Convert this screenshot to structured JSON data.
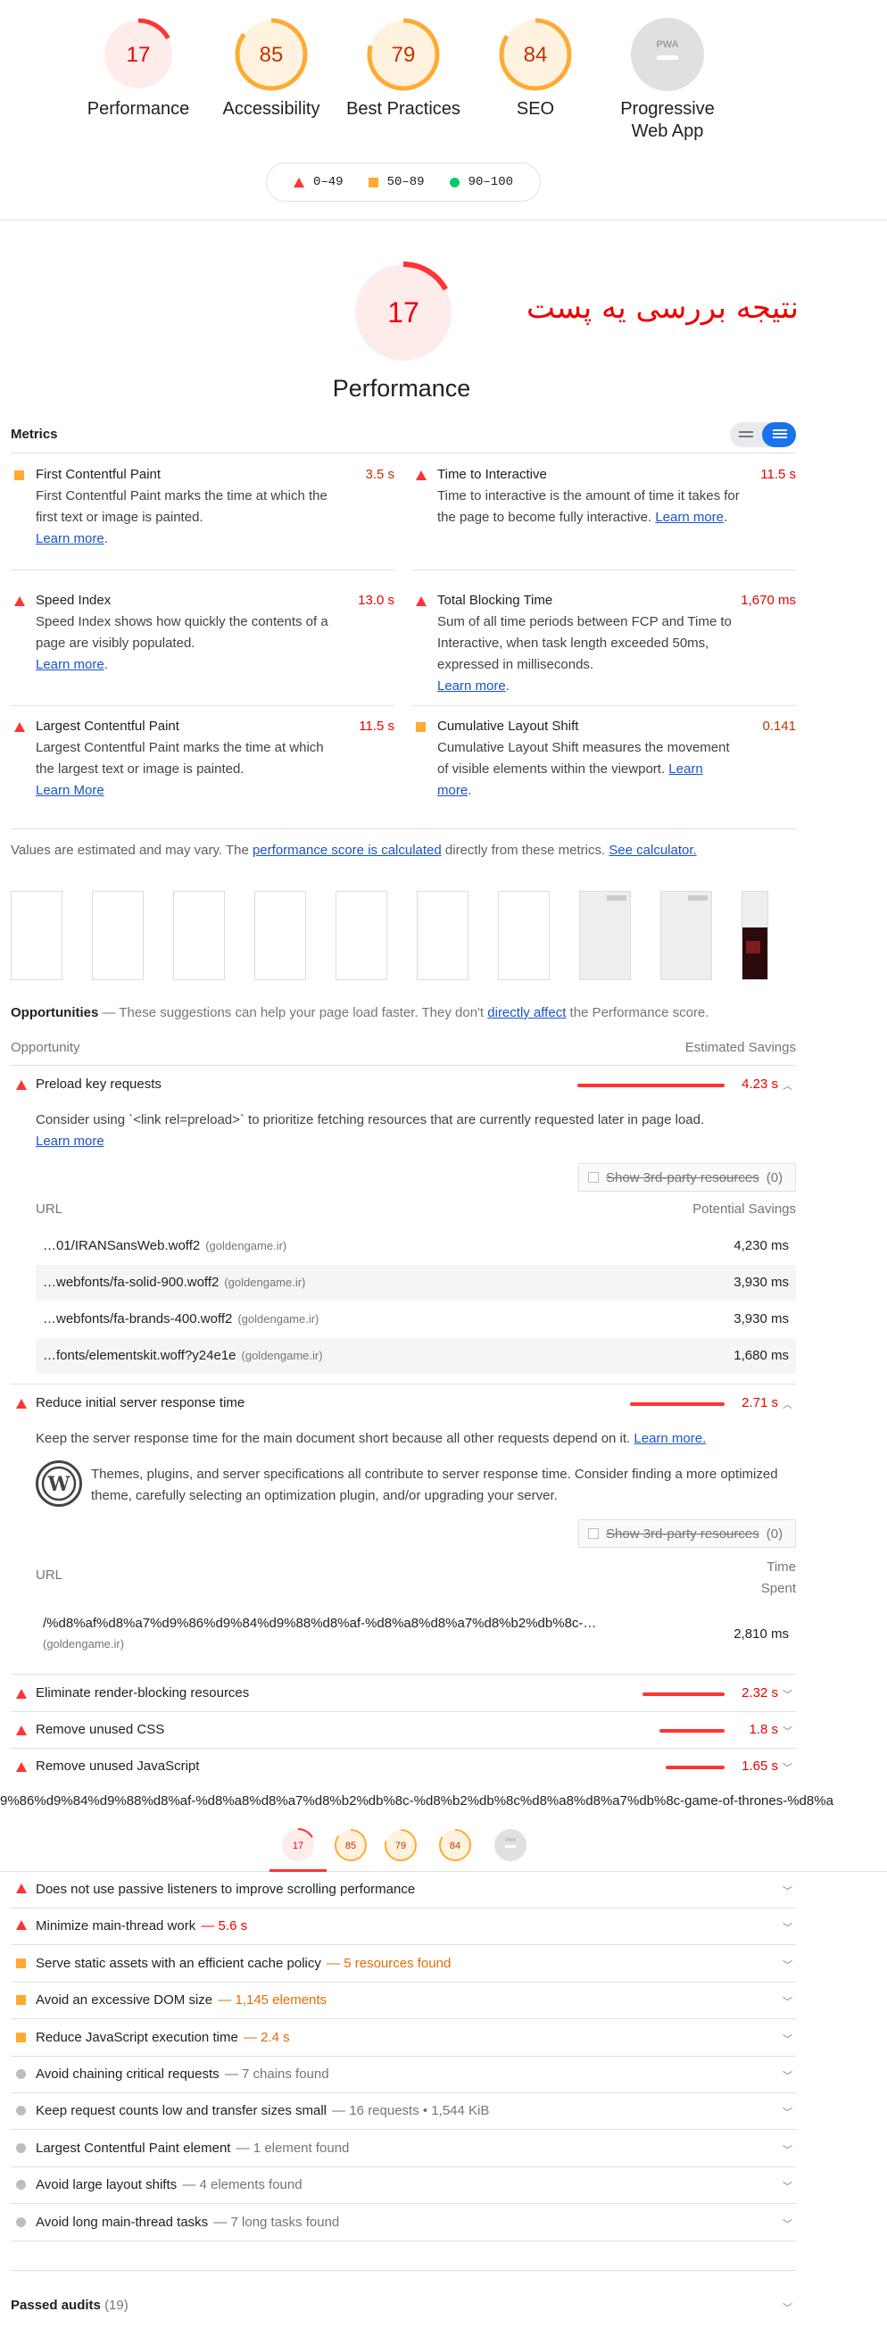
{
  "categories": [
    {
      "score": "17",
      "label": "Performance",
      "color": "#ff3333",
      "bg": "#fdecea",
      "fraction": 0.17
    },
    {
      "score": "85",
      "label": "Accessibility",
      "color": "#ffaa33",
      "bg": "#fff3e0",
      "fraction": 0.85
    },
    {
      "score": "79",
      "label": "Best Practices",
      "color": "#ffaa33",
      "bg": "#fff3e0",
      "fraction": 0.79
    },
    {
      "score": "84",
      "label": "SEO",
      "color": "#ffaa33",
      "bg": "#fff3e0",
      "fraction": 0.84
    },
    {
      "score": "PWA",
      "label": "Progressive Web App",
      "color": "#9e9e9e",
      "bg": "#e0e0e0",
      "fraction": 0
    }
  ],
  "legend": {
    "fail": "0–49",
    "average": "50–89",
    "pass": "90–100"
  },
  "annotation": "نتیجه بررسی یه پست",
  "perf": {
    "score": "17",
    "title": "Performance"
  },
  "metrics": {
    "title": "Metrics",
    "items": [
      {
        "name": "First Contentful Paint",
        "value": "3.5 s",
        "desc": "First Contentful Paint marks the time at which the first text or image is painted.",
        "link": "Learn more",
        "status": "average"
      },
      {
        "name": "Time to Interactive",
        "value": "11.5 s",
        "desc": "Time to interactive is the amount of time it takes for the page to become fully interactive.",
        "link": "Learn more",
        "status": "fail"
      },
      {
        "name": "Speed Index",
        "value": "13.0 s",
        "desc": "Speed Index shows how quickly the contents of a page are visibly populated.",
        "link": "Learn more",
        "status": "fail"
      },
      {
        "name": "Total Blocking Time",
        "value": "1,670 ms",
        "desc": "Sum of all time periods between FCP and Time to Interactive, when task length exceeded 50ms, expressed in milliseconds.",
        "link": "Learn more",
        "status": "fail"
      },
      {
        "name": "Largest Contentful Paint",
        "value": "11.5 s",
        "desc": "Largest Contentful Paint marks the time at which the largest text or image is painted.",
        "link": "Learn More",
        "status": "fail"
      },
      {
        "name": "Cumulative Layout Shift",
        "value": "0.141",
        "desc": "Cumulative Layout Shift measures the movement of visible elements within the viewport.",
        "link": "Learn more",
        "status": "average"
      }
    ]
  },
  "values_note": {
    "pre": "Values are estimated and may vary. The ",
    "link1": "performance score is calculated",
    "mid": " directly from these metrics. ",
    "link2": "See calculator."
  },
  "opportunities": {
    "title": "Opportunities",
    "subtitle": " — These suggestions can help your page load faster. They don't ",
    "link": "directly affect",
    "tail": " the Performance score.",
    "col_opportunity": "Opportunity",
    "col_savings": "Estimated Savings",
    "third_party": "Show 3rd-party resources",
    "third_count": "(0)",
    "url_col": "URL",
    "potential_col": "Potential Savings",
    "time_spent_1": "Time",
    "time_spent_2": "Spent",
    "preload": {
      "title": "Preload key requests",
      "savings": "4.23 s",
      "fraction": 0.5,
      "desc": "Consider using `<link rel=preload>` to prioritize fetching resources that are currently requested later in page load.",
      "link": "Learn more",
      "rows": [
        {
          "url": "…01/IRANSansWeb.woff2",
          "host": "(goldengame.ir)",
          "value": "4,230 ms"
        },
        {
          "url": "…webfonts/fa-solid-900.woff2",
          "host": "(goldengame.ir)",
          "value": "3,930 ms"
        },
        {
          "url": "…webfonts/fa-brands-400.woff2",
          "host": "(goldengame.ir)",
          "value": "3,930 ms"
        },
        {
          "url": "…fonts/elementskit.woff?y24e1e",
          "host": "(goldengame.ir)",
          "value": "1,680 ms"
        }
      ]
    },
    "server": {
      "title": "Reduce initial server response time",
      "savings": "2.71 s",
      "fraction": 0.32,
      "desc": "Keep the server response time for the main document short because all other requests depend on it. ",
      "link": "Learn more.",
      "wp_text": "Themes, plugins, and server specifications all contribute to server response time. Consider finding a more optimized theme, carefully selecting an optimization plugin, and/or upgrading your server.",
      "row_url": "/%d8%af%d8%a7%d9%86%d9%84%d9%88%d8%af-%d8%a8%d8%a7%d8%b2%db%8c-…",
      "row_host": "(goldengame.ir)",
      "row_value": "2,810 ms"
    },
    "others": [
      {
        "title": "Eliminate render-blocking resources",
        "savings": "2.32 s",
        "fraction": 0.28
      },
      {
        "title": "Remove unused CSS",
        "savings": "1.8 s",
        "fraction": 0.22
      },
      {
        "title": "Remove unused JavaScript",
        "savings": "1.65 s",
        "fraction": 0.2
      }
    ]
  },
  "url_strip": "9%86%d9%84%d9%88%d8%af-%d8%a8%d8%a7%d8%b2%db%8c-%d8%b2%db%8c%d8%a8%d8%a7%db%8c-game-of-thrones-%d8%a",
  "mini_scores": [
    "17",
    "85",
    "79",
    "84",
    "PWA"
  ],
  "diagnostics": [
    {
      "title": "Does not use passive listeners to improve scrolling performance",
      "detail": "",
      "status": "fail"
    },
    {
      "title": "Minimize main-thread work",
      "detail": "— 5.6 s",
      "status": "fail"
    },
    {
      "title": "Serve static assets with an efficient cache policy",
      "detail": "— 5 resources found",
      "status": "average"
    },
    {
      "title": "Avoid an excessive DOM size",
      "detail": "— 1,145 elements",
      "status": "average"
    },
    {
      "title": "Reduce JavaScript execution time",
      "detail": "— 2.4 s",
      "status": "average"
    },
    {
      "title": "Avoid chaining critical requests",
      "detail": "— 7 chains found",
      "status": "info"
    },
    {
      "title": "Keep request counts low and transfer sizes small",
      "detail": "— 16 requests • 1,544 KiB",
      "status": "info"
    },
    {
      "title": "Largest Contentful Paint element",
      "detail": "— 1 element found",
      "status": "info"
    },
    {
      "title": "Avoid large layout shifts",
      "detail": "— 4 elements found",
      "status": "info"
    },
    {
      "title": "Avoid long main-thread tasks",
      "detail": "— 7 long tasks found",
      "status": "info"
    }
  ],
  "passed": {
    "label": "Passed audits",
    "count": "(19)"
  }
}
